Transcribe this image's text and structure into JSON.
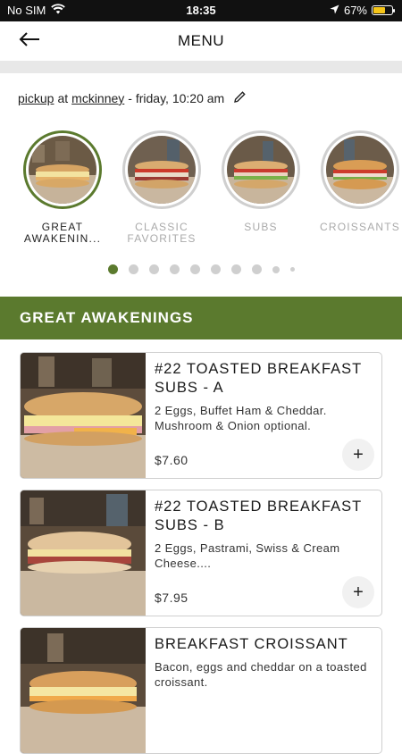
{
  "status_bar": {
    "carrier": "No SIM",
    "time": "18:35",
    "battery": "67%",
    "battery_level": 0.67,
    "icons": [
      "wifi-icon",
      "location-arrow-icon",
      "battery-icon"
    ]
  },
  "header": {
    "title": "MENU",
    "back_icon": "arrow-left-icon"
  },
  "pickup": {
    "mode": "pickup",
    "connector": "at",
    "location": "mckinney",
    "when": "- friday, 10:20 am",
    "edit_icon": "pencil-icon"
  },
  "categories": [
    {
      "label": "GREAT AWAKENIN...",
      "active": true
    },
    {
      "label": "CLASSIC FAVORITES",
      "active": false
    },
    {
      "label": "SUBS",
      "active": false
    },
    {
      "label": "CROISSANTS",
      "active": false
    }
  ],
  "pagination": {
    "total": 10,
    "active_index": 0
  },
  "section": {
    "title": "GREAT AWAKENINGS"
  },
  "items": [
    {
      "name": "#22 TOASTED BREAKFAST SUBS - A",
      "description": "2 Eggs, Buffet Ham & Cheddar. Mushroom & Onion optional.",
      "price": "$7.60",
      "add_label": "+"
    },
    {
      "name": "#22 TOASTED BREAKFAST SUBS - B",
      "description": "2 Eggs, Pastrami, Swiss & Cream Cheese....",
      "price": "$7.95",
      "add_label": "+"
    },
    {
      "name": "BREAKFAST CROISSANT",
      "description": "Bacon, eggs and cheddar on a toasted croissant.",
      "price": "",
      "add_label": "+"
    }
  ],
  "colors": {
    "accent": "#5b7a2e",
    "inactive": "#cfcfcf",
    "band": "#e8e8e8"
  }
}
